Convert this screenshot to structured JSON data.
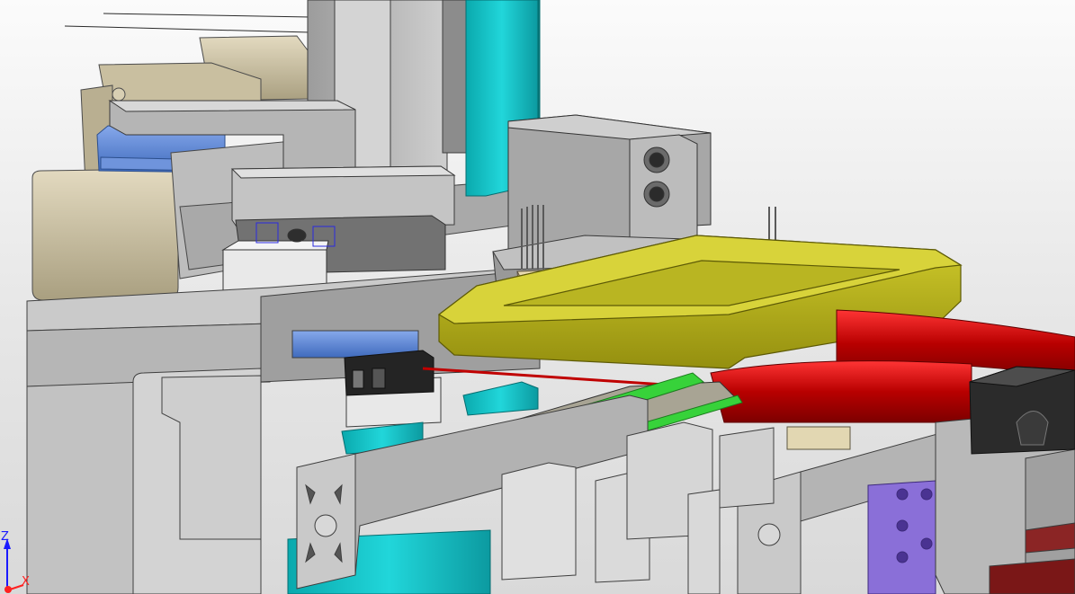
{
  "viewport": {
    "background_top": "#fbfbfb",
    "background_bottom": "#d9d9d9"
  },
  "colors": {
    "aluminum": "#c8c8c8",
    "steel": "#9a9a9a",
    "cyan_part": "#11c2c6",
    "yellow_frame": "#b4b01c",
    "red_cable": "#d20d0d",
    "green_belt": "#37d23a",
    "blue_part": "#5b87d6",
    "beige_motor": "#cdc3a5",
    "purple_part": "#8a6fd8",
    "black_sensor": "#2a2a2a"
  },
  "triad": {
    "z_label": "Z",
    "x_label": "X",
    "z_color": "#1a1aff",
    "x_color": "#ff2020"
  }
}
